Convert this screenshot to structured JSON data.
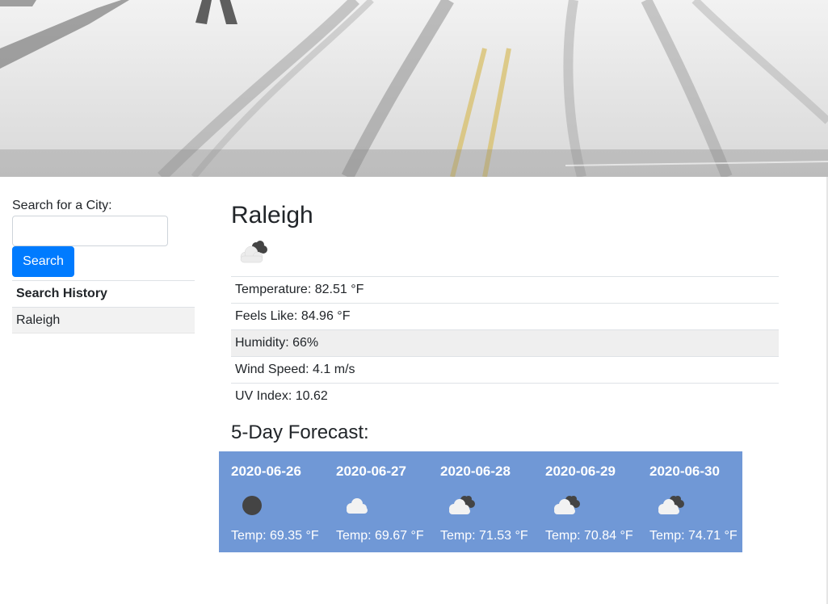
{
  "hero": {
    "alt_icon": "snowy-road-image"
  },
  "sidebar": {
    "search_label": "Search for a City:",
    "search_value": "",
    "search_placeholder": "",
    "search_button": "Search",
    "history_title": "Search History",
    "history_items": [
      "Raleigh"
    ]
  },
  "current": {
    "city": "Raleigh",
    "icon": "broken-clouds-icon",
    "temperature": "Temperature: 82.51 °F",
    "feels_like": "Feels Like: 84.96 °F",
    "humidity": "Humidity: 66%",
    "wind": "Wind Speed: 4.1 m/s",
    "uv": "UV Index: 10.62"
  },
  "forecast": {
    "title": "5-Day Forecast:",
    "accent_color": "#7098d6",
    "days": [
      {
        "date": "2020-06-26",
        "icon": "overcast-icon",
        "temp": "Temp: 69.35 °F"
      },
      {
        "date": "2020-06-27",
        "icon": "cloud-icon",
        "temp": "Temp: 69.67 °F"
      },
      {
        "date": "2020-06-28",
        "icon": "broken-clouds-icon",
        "temp": "Temp: 71.53 °F"
      },
      {
        "date": "2020-06-29",
        "icon": "broken-clouds-icon",
        "temp": "Temp: 70.84 °F"
      },
      {
        "date": "2020-06-30",
        "icon": "broken-clouds-icon",
        "temp": "Temp: 74.71 °F"
      }
    ]
  },
  "colors": {
    "primary_button": "#007bff",
    "shaded_row": "#efefef"
  }
}
